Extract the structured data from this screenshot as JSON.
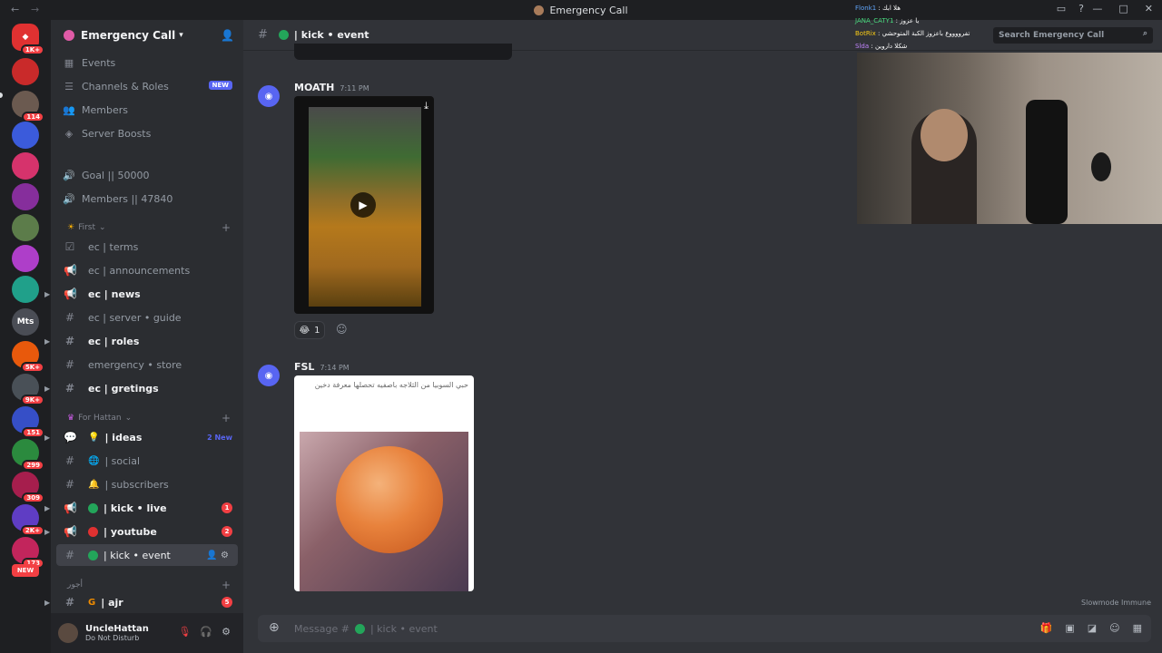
{
  "window": {
    "title": "Emergency Call"
  },
  "server": {
    "name": "Emergency Call"
  },
  "guild_badges": [
    "1K+",
    "114",
    "5K+",
    "9K+",
    "151",
    "299",
    "309",
    "2K+",
    "173",
    "NEW"
  ],
  "guild_mts_label": "Mts",
  "nav": [
    {
      "label": "Events",
      "icon": "calendar-icon"
    },
    {
      "label": "Channels & Roles",
      "icon": "channels-icon",
      "tag": "NEW"
    },
    {
      "label": "Members",
      "icon": "members-icon"
    },
    {
      "label": "Server Boosts",
      "icon": "boost-icon"
    }
  ],
  "stat_channels": [
    {
      "label": "Goal || 50000"
    },
    {
      "label": "Members || 47840"
    }
  ],
  "categories": {
    "first": "First",
    "hattan": "For Hattan",
    "last": "أجور"
  },
  "channels": {
    "terms": "ec | terms",
    "announcements": "ec | announcements",
    "news": "ec | news",
    "guide": "ec | server • guide",
    "roles": "ec | roles",
    "store": "emergency • store",
    "greetings": "ec | gretings",
    "ideas": "| ideas",
    "ideas_new": "2 New",
    "social": "| social",
    "subscribers": "| subscribers",
    "kick_live": "| kick • live",
    "kick_live_mentions": "1",
    "youtube": "| youtube",
    "youtube_mentions": "2",
    "kick_event": "| kick • event",
    "ajr": "| ajr",
    "ajr_mentions": "5"
  },
  "user": {
    "name": "UncleHattan",
    "status": "Do Not Disturb"
  },
  "channel_header": {
    "name": "| kick • event"
  },
  "search": {
    "placeholder": "Search Emergency Call"
  },
  "messages": [
    {
      "author": "MOATH",
      "time": "7:11 PM",
      "reaction_emoji": "😂",
      "reaction_count": "1"
    },
    {
      "author": "FSL",
      "time": "7:14 PM",
      "embed_text": "حبي السوبيا من الثلاجه باصفيه تحصلها معرفة دخين"
    }
  ],
  "slowmode": "Slowmode Immune",
  "composer": {
    "placeholder_prefix": "Message #",
    "placeholder_channel": "| kick • event"
  },
  "stream_chat": [
    {
      "user": "Flonk1",
      "text": ": هلا ابك"
    },
    {
      "user": "JANA_CATY1",
      "text": ": يا عزوز"
    },
    {
      "user": "BotRix",
      "text": ": تفرووووع باعزوز الكبة المتوحشي"
    },
    {
      "user": "Slda",
      "text": ": شكلا داروين"
    }
  ]
}
